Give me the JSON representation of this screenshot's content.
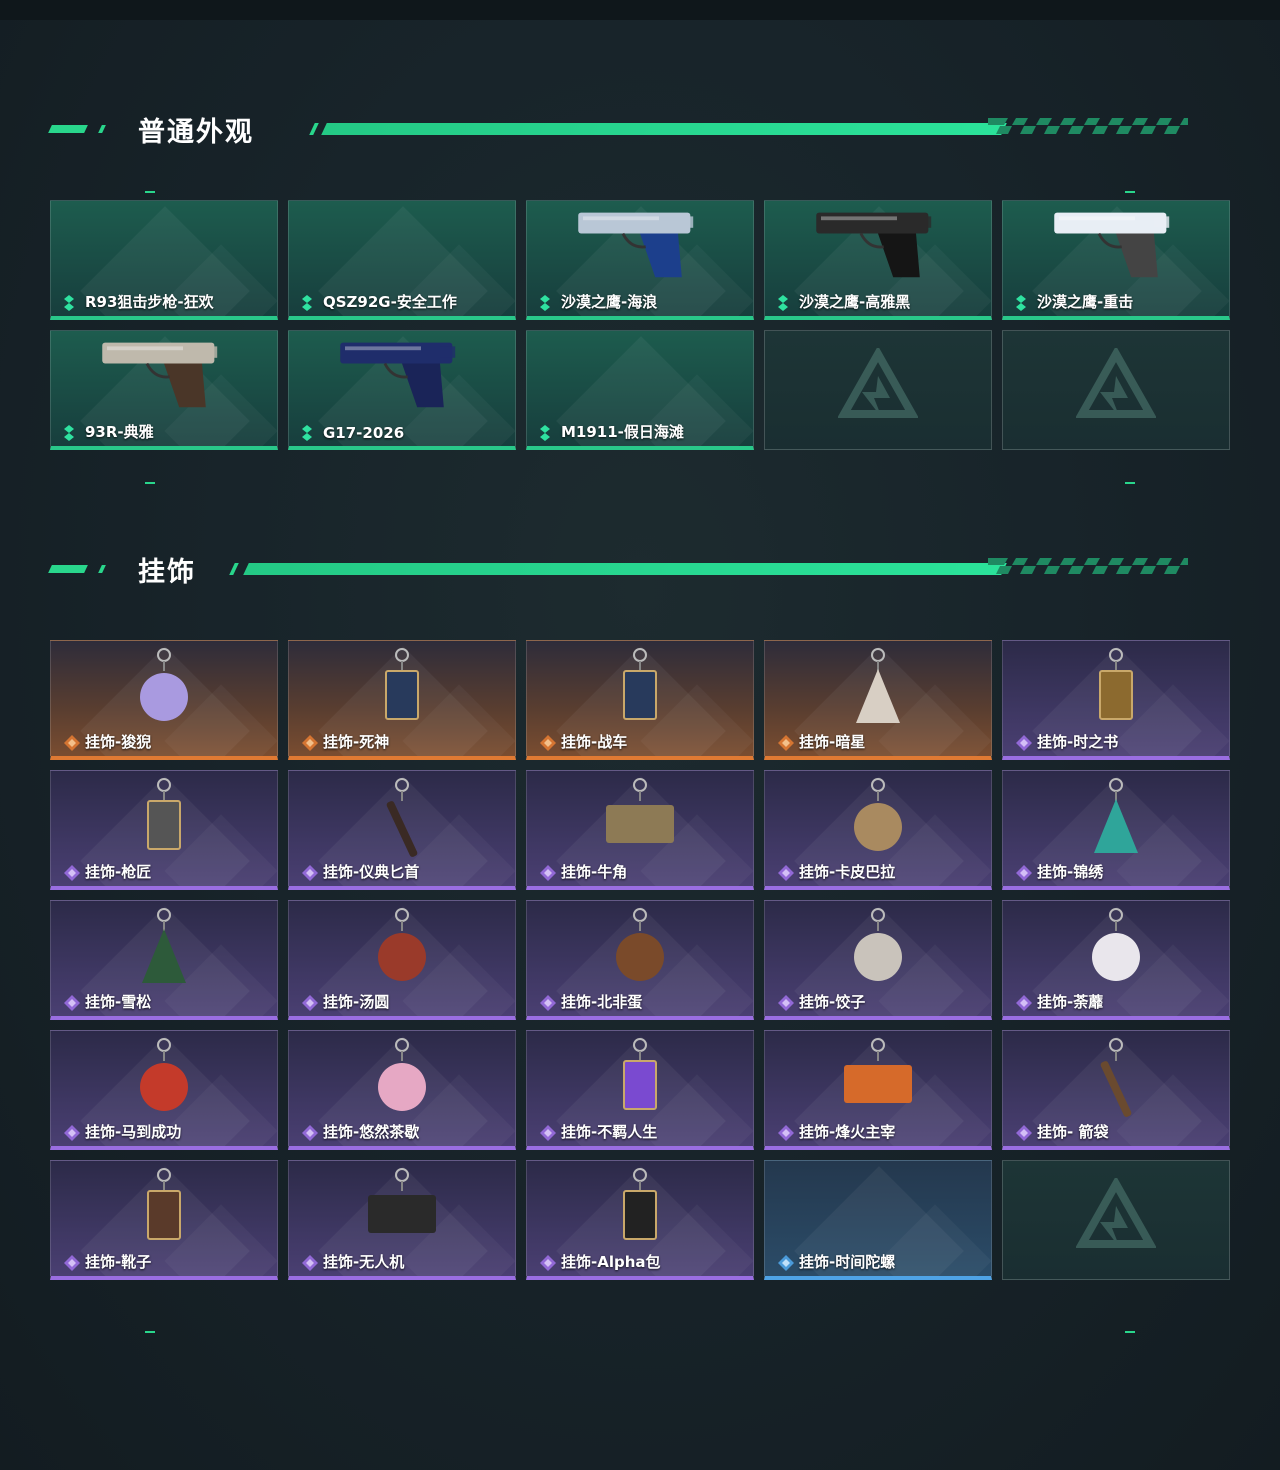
{
  "sections": [
    {
      "title": "普通外观",
      "items": [
        {
          "label": "R93狙击步枪-狂欢",
          "rarity": "green",
          "art": "none"
        },
        {
          "label": "QSZ92G-安全工作",
          "rarity": "green",
          "art": "none"
        },
        {
          "label": "沙漠之鹰-海浪",
          "rarity": "green",
          "art": "pistol-blue-icon"
        },
        {
          "label": "沙漠之鹰-高雅黑",
          "rarity": "green",
          "art": "pistol-black-icon"
        },
        {
          "label": "沙漠之鹰-重击",
          "rarity": "green",
          "art": "pistol-white-icon"
        },
        {
          "label": "93R-典雅",
          "rarity": "green",
          "art": "pistol-silver-icon"
        },
        {
          "label": "G17-2026",
          "rarity": "green",
          "art": "pistol-navy-icon"
        },
        {
          "label": "M1911-假日海滩",
          "rarity": "green",
          "art": "none"
        },
        {
          "label": "",
          "rarity": "empty",
          "art": "logo-icon"
        },
        {
          "label": "",
          "rarity": "empty",
          "art": "logo-icon"
        }
      ]
    },
    {
      "title": "挂饰",
      "items": [
        {
          "label": "挂饰-狻猊",
          "rarity": "orange",
          "art": "lion-charm-icon"
        },
        {
          "label": "挂饰-死神",
          "rarity": "orange",
          "art": "card-charm-icon"
        },
        {
          "label": "挂饰-战车",
          "rarity": "orange",
          "art": "card-charm-icon"
        },
        {
          "label": "挂饰-暗星",
          "rarity": "orange",
          "art": "feather-charm-icon"
        },
        {
          "label": "挂饰-时之书",
          "rarity": "purple",
          "art": "book-charm-icon"
        },
        {
          "label": "挂饰-枪匠",
          "rarity": "purple",
          "art": "box-charm-icon"
        },
        {
          "label": "挂饰-仪典匕首",
          "rarity": "purple",
          "art": "dagger-charm-icon"
        },
        {
          "label": "挂饰-牛角",
          "rarity": "purple",
          "art": "horn-charm-icon"
        },
        {
          "label": "挂饰-卡皮巴拉",
          "rarity": "purple",
          "art": "capybara-charm-icon"
        },
        {
          "label": "挂饰-锦绣",
          "rarity": "purple",
          "art": "butterfly-charm-icon"
        },
        {
          "label": "挂饰-雪松",
          "rarity": "purple",
          "art": "tree-charm-icon"
        },
        {
          "label": "挂饰-汤圆",
          "rarity": "purple",
          "art": "bowl-charm-icon"
        },
        {
          "label": "挂饰-北非蛋",
          "rarity": "purple",
          "art": "pan-charm-icon"
        },
        {
          "label": "挂饰-饺子",
          "rarity": "purple",
          "art": "plate-charm-icon"
        },
        {
          "label": "挂饰-荼蘼",
          "rarity": "purple",
          "art": "flower-charm-icon"
        },
        {
          "label": "挂饰-马到成功",
          "rarity": "purple",
          "art": "horse-charm-icon"
        },
        {
          "label": "挂饰-悠然茶歇",
          "rarity": "purple",
          "art": "cupcake-charm-icon"
        },
        {
          "label": "挂饰-不羁人生",
          "rarity": "purple",
          "art": "sneaker-charm-icon"
        },
        {
          "label": "挂饰-烽火主宰",
          "rarity": "purple",
          "art": "sign-charm-icon"
        },
        {
          "label": "挂饰- 箭袋",
          "rarity": "purple",
          "art": "quiver-charm-icon"
        },
        {
          "label": "挂饰-靴子",
          "rarity": "purple",
          "art": "boot-charm-icon"
        },
        {
          "label": "挂饰-无人机",
          "rarity": "purple",
          "art": "drone-charm-icon"
        },
        {
          "label": "挂饰-Alpha包",
          "rarity": "purple",
          "art": "bag-charm-icon"
        },
        {
          "label": "挂饰-时间陀螺",
          "rarity": "blue",
          "art": "none"
        },
        {
          "label": "",
          "rarity": "empty",
          "art": "logo-icon"
        }
      ]
    }
  ],
  "colors": {
    "accent": "#29d68c",
    "green": "#29c88a",
    "orange": "#e07a33",
    "purple": "#9a6ee2",
    "blue": "#4fa3e6"
  }
}
